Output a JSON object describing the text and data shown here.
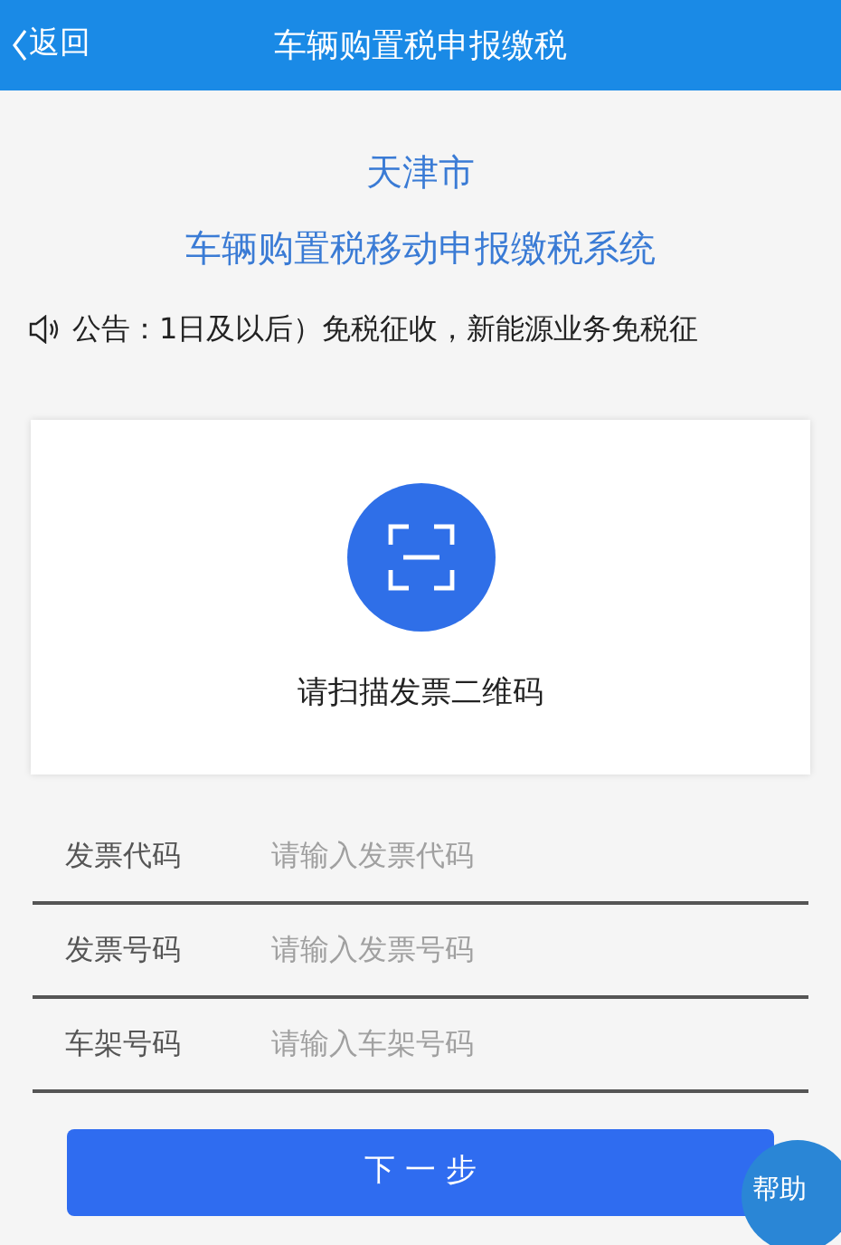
{
  "header": {
    "back": "返回",
    "title": "车辆购置税申报缴税"
  },
  "city": "天津市",
  "system_title": "车辆购置税移动申报缴税系统",
  "notice": "公告：1日及以后）免税征收，新能源业务免税征",
  "scan": {
    "label": "请扫描发票二维码"
  },
  "fields": [
    {
      "label": "发票代码",
      "placeholder": "请输入发票代码"
    },
    {
      "label": "发票号码",
      "placeholder": "请输入发票号码"
    },
    {
      "label": "车架号码",
      "placeholder": "请输入车架号码"
    }
  ],
  "next_button": "下 一 步",
  "help": "帮助"
}
